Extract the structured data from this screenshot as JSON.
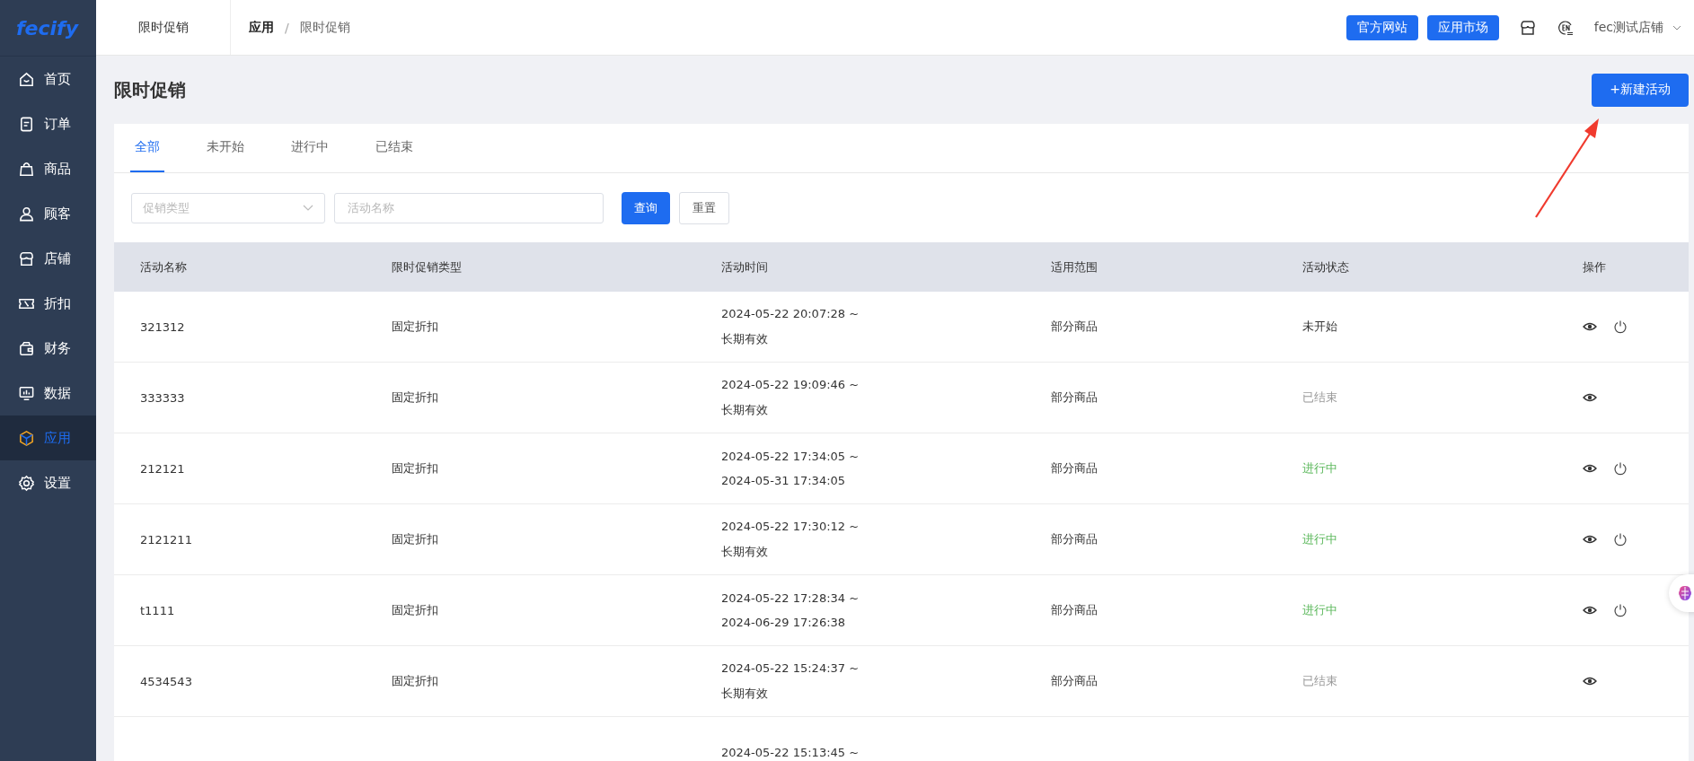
{
  "logo": {
    "text": "fecify"
  },
  "sidebar": {
    "items": [
      {
        "label": "首页",
        "kind": "home",
        "selected": false
      },
      {
        "label": "订单",
        "kind": "order",
        "selected": false
      },
      {
        "label": "商品",
        "kind": "bag",
        "selected": false
      },
      {
        "label": "顾客",
        "kind": "user",
        "selected": false
      },
      {
        "label": "店铺",
        "kind": "store",
        "selected": false
      },
      {
        "label": "折扣",
        "kind": "ticket",
        "selected": false
      },
      {
        "label": "财务",
        "kind": "wallet",
        "selected": false
      },
      {
        "label": "数据",
        "kind": "monitor",
        "selected": false
      },
      {
        "label": "应用",
        "kind": "box",
        "selected": true
      },
      {
        "label": "设置",
        "kind": "gear",
        "selected": false
      }
    ]
  },
  "header": {
    "page_tab": "限时促销",
    "breadcrumb": [
      "应用",
      "限时促销"
    ],
    "breadcrumb_separator": "/",
    "buttons": [
      "官方网站",
      "应用市场"
    ],
    "store_name": "fec测试店铺"
  },
  "page": {
    "title": "限时促销",
    "new_button": "+新建活动"
  },
  "tabs": [
    {
      "label": "全部",
      "selected": true
    },
    {
      "label": "未开始",
      "selected": false
    },
    {
      "label": "进行中",
      "selected": false
    },
    {
      "label": "已结束",
      "selected": false
    }
  ],
  "filters": {
    "type_select": {
      "placeholder": "促销类型"
    },
    "name_field": {
      "placeholder": "活动名称"
    },
    "search_button": "查询",
    "reset_button": "重置"
  },
  "table": {
    "columns": [
      "活动名称",
      "限时促销类型",
      "活动时间",
      "适用范围",
      "活动状态",
      "操作"
    ],
    "rows": [
      {
        "name": "321312",
        "type": "固定折扣",
        "start": "2024-05-22 20:07:28 ~",
        "end": "长期有效",
        "scope": "部分商品",
        "status": "未开始",
        "kind": "pending",
        "actions": [
          {
            "kind": "view"
          },
          {
            "kind": "power"
          }
        ]
      },
      {
        "name": "333333",
        "type": "固定折扣",
        "start": "2024-05-22 19:09:46 ~",
        "end": "长期有效",
        "scope": "部分商品",
        "status": "已结束",
        "kind": "ended",
        "actions": [
          {
            "kind": "view"
          }
        ]
      },
      {
        "name": "212121",
        "type": "固定折扣",
        "start": "2024-05-22 17:34:05 ~",
        "end": "2024-05-31 17:34:05",
        "scope": "部分商品",
        "status": "进行中",
        "kind": "running",
        "actions": [
          {
            "kind": "view"
          },
          {
            "kind": "power"
          }
        ]
      },
      {
        "name": "2121211",
        "type": "固定折扣",
        "start": "2024-05-22 17:30:12 ~",
        "end": "长期有效",
        "scope": "部分商品",
        "status": "进行中",
        "kind": "running",
        "actions": [
          {
            "kind": "view"
          },
          {
            "kind": "power"
          }
        ]
      },
      {
        "name": "t1111",
        "type": "固定折扣",
        "start": "2024-05-22 17:28:34 ~",
        "end": "2024-06-29 17:26:38",
        "scope": "部分商品",
        "status": "进行中",
        "kind": "running",
        "actions": [
          {
            "kind": "view"
          },
          {
            "kind": "power"
          }
        ]
      },
      {
        "name": "4534543",
        "type": "固定折扣",
        "start": "2024-05-22 15:24:37 ~",
        "end": "长期有效",
        "scope": "部分商品",
        "status": "已结束",
        "kind": "ended",
        "actions": [
          {
            "kind": "view"
          }
        ]
      },
      {
        "start": "2024-05-22 15:13:45 ~"
      }
    ]
  }
}
